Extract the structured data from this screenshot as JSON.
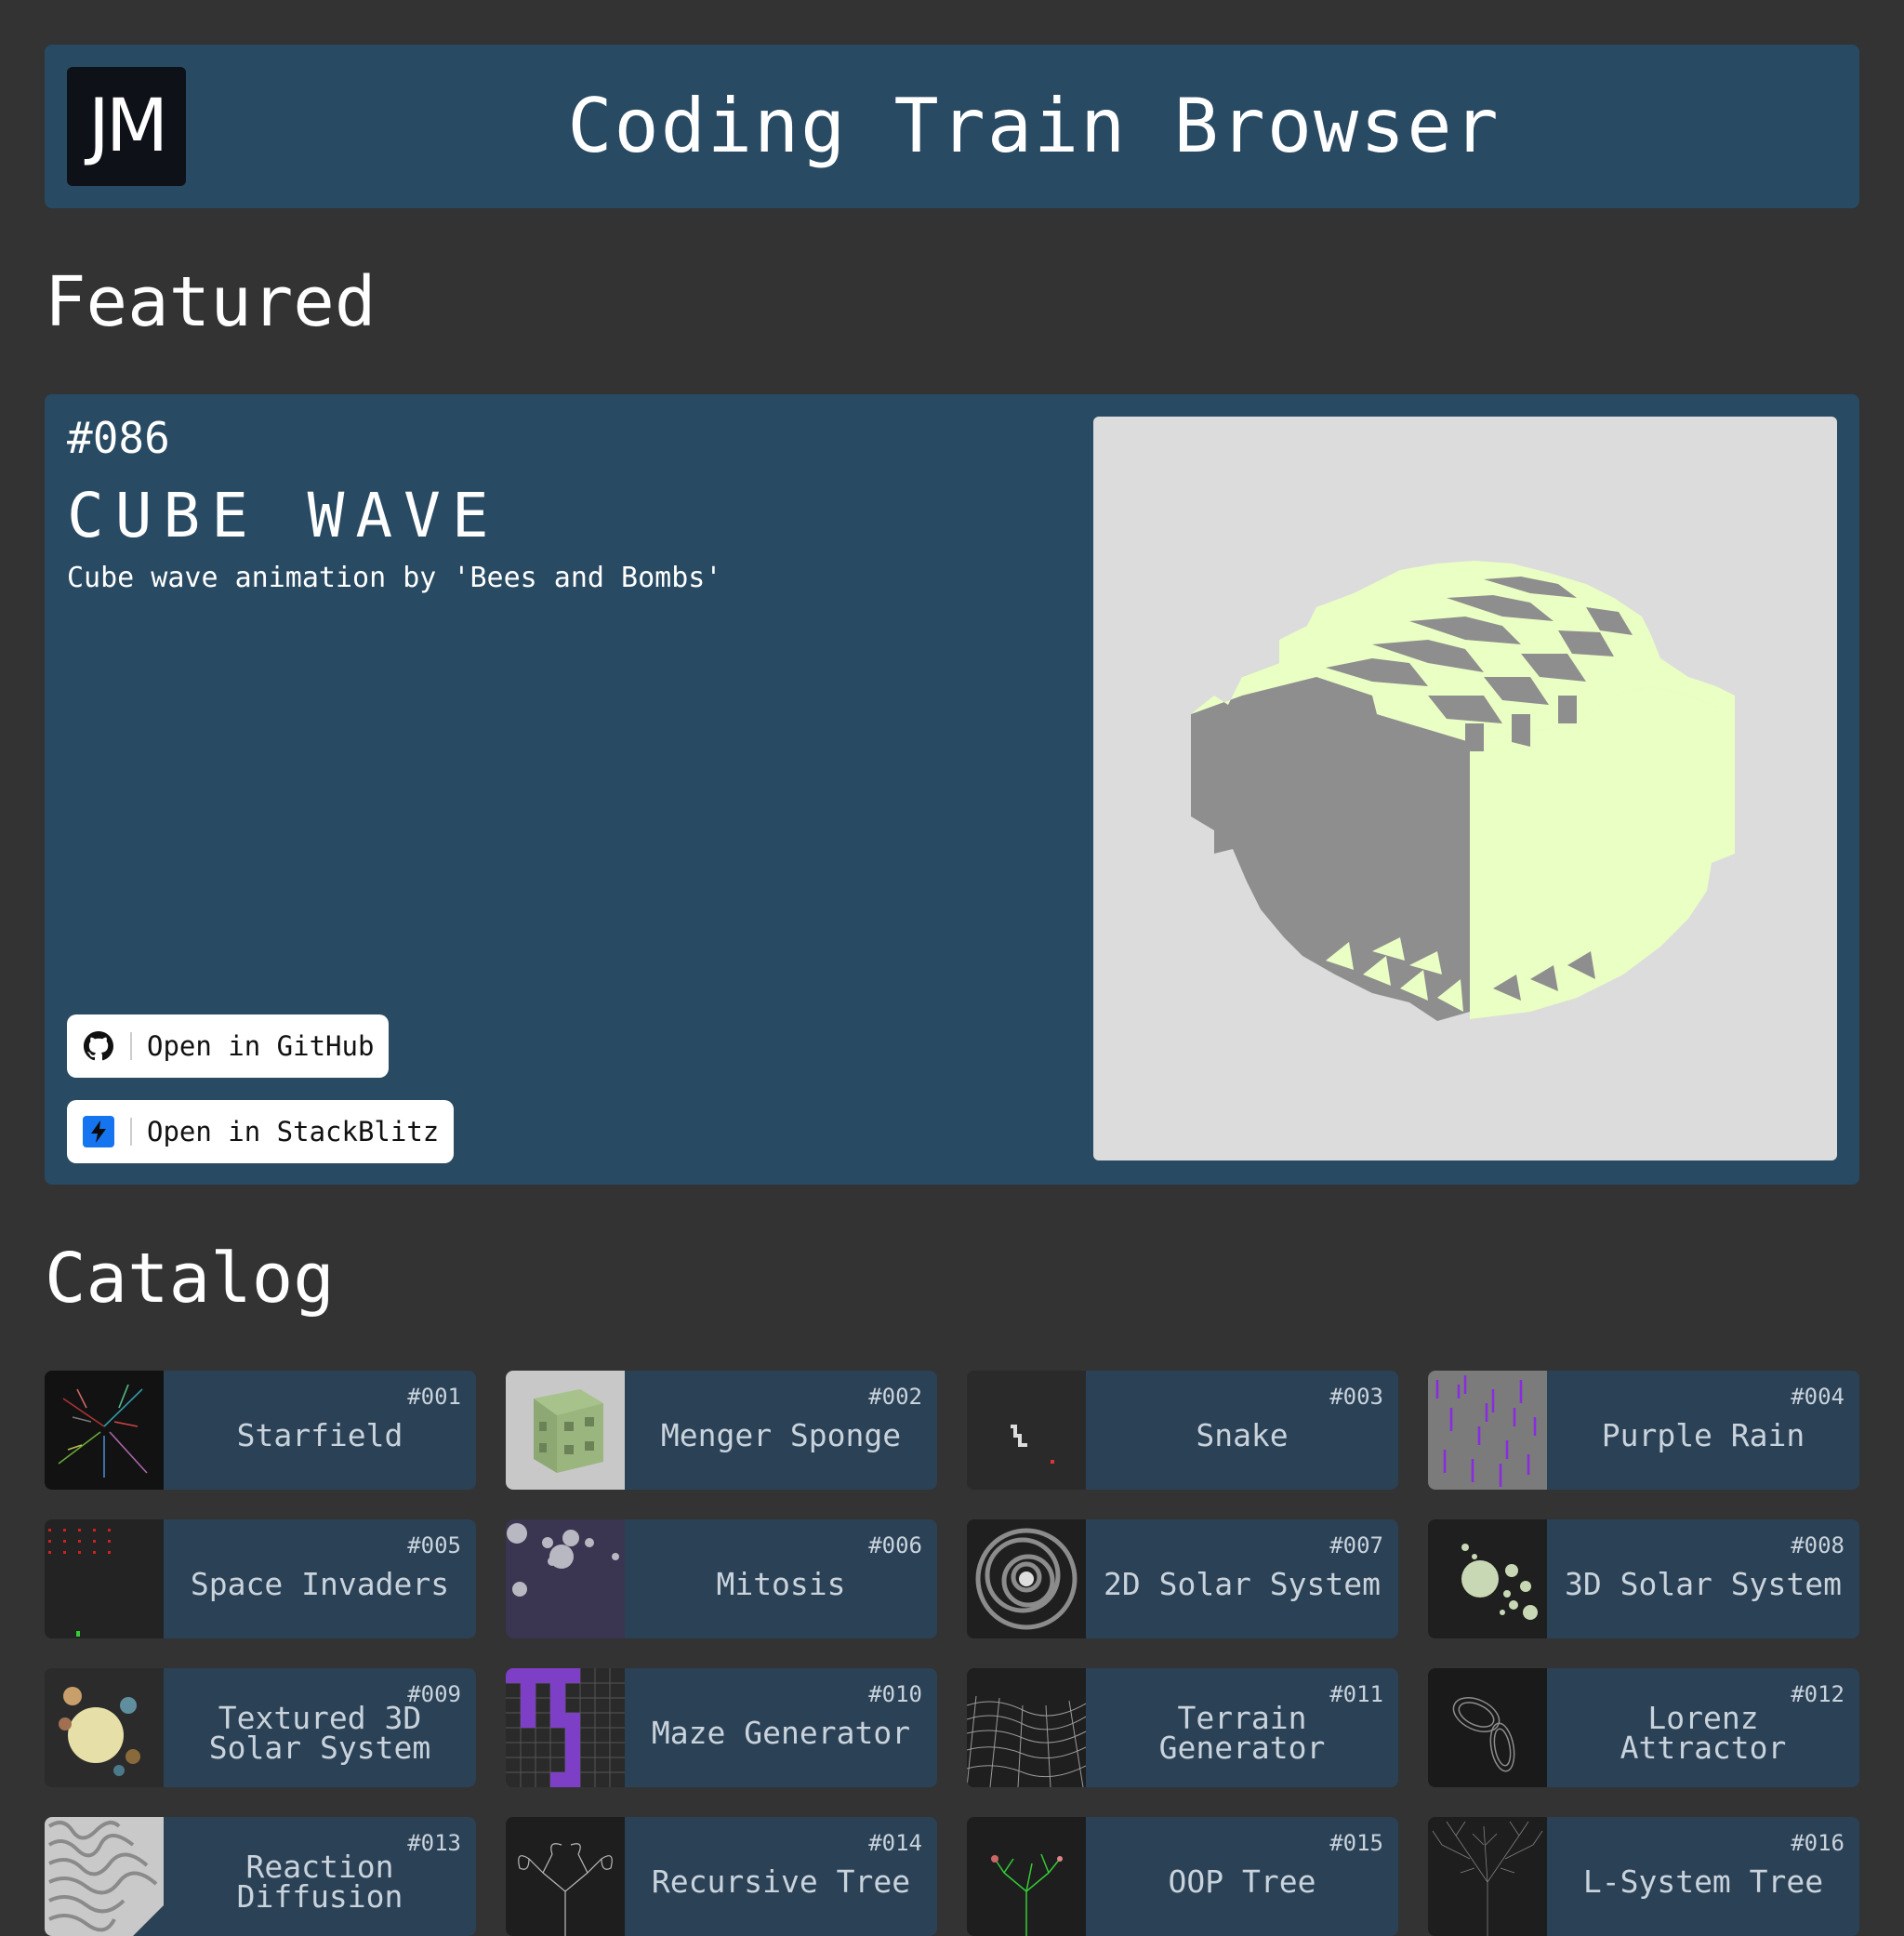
{
  "header": {
    "logo_text": "JM",
    "title": "Coding Train Browser"
  },
  "featured": {
    "heading": "Featured",
    "number": "#086",
    "title": "CUBE WAVE",
    "description": "Cube wave animation by 'Bees and Bombs'",
    "github_label": "Open in GitHub",
    "stackblitz_label": "Open in StackBlitz"
  },
  "catalog": {
    "heading": "Catalog",
    "items": [
      {
        "number": "#001",
        "name": "Starfield",
        "thumb": "starfield"
      },
      {
        "number": "#002",
        "name": "Menger Sponge",
        "thumb": "menger"
      },
      {
        "number": "#003",
        "name": "Snake",
        "thumb": "snake"
      },
      {
        "number": "#004",
        "name": "Purple Rain",
        "thumb": "rain"
      },
      {
        "number": "#005",
        "name": "Space Invaders",
        "thumb": "invaders"
      },
      {
        "number": "#006",
        "name": "Mitosis",
        "thumb": "mitosis"
      },
      {
        "number": "#007",
        "name": "2D Solar System",
        "thumb": "solar2d"
      },
      {
        "number": "#008",
        "name": "3D Solar System",
        "thumb": "solar3d"
      },
      {
        "number": "#009",
        "name": "Textured 3D Solar System",
        "thumb": "textured"
      },
      {
        "number": "#010",
        "name": "Maze Generator",
        "thumb": "maze"
      },
      {
        "number": "#011",
        "name": "Terrain Generator",
        "thumb": "terrain"
      },
      {
        "number": "#012",
        "name": "Lorenz Attractor",
        "thumb": "lorenz"
      },
      {
        "number": "#013",
        "name": "Reaction Diffusion",
        "thumb": "reaction"
      },
      {
        "number": "#014",
        "name": "Recursive Tree",
        "thumb": "rtree"
      },
      {
        "number": "#015",
        "name": "OOP Tree",
        "thumb": "ooptree"
      },
      {
        "number": "#016",
        "name": "L-System Tree",
        "thumb": "lsystem"
      }
    ]
  },
  "colors": {
    "background": "#333333",
    "panel": "#284a63",
    "tile": "#2b4156",
    "cube_top": "#eaffc4",
    "cube_side": "#8e8e8e"
  }
}
